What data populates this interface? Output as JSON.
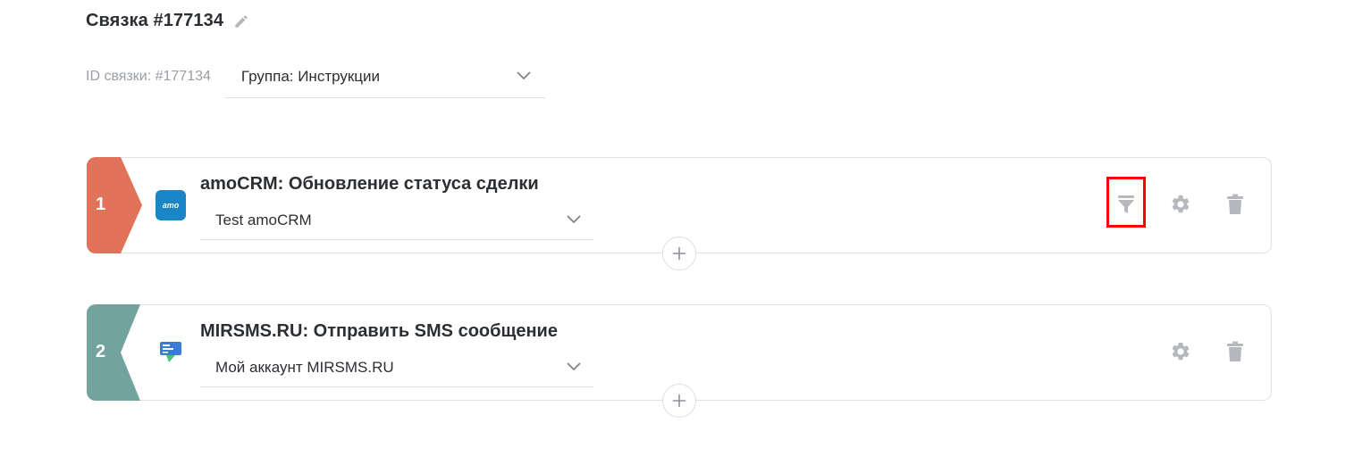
{
  "header": {
    "title": "Связка #177134",
    "id_label": "ID связки: #177134",
    "group_value": "Группа: Инструкции"
  },
  "steps": [
    {
      "number": "1",
      "badge_color": "#e0735a",
      "title": "amoCRM: Обновление статуса сделки",
      "account": "Test amoCRM",
      "logo_text": "amo",
      "logo_color": "#1a86c6",
      "actions": [
        "filter-icon",
        "gear-icon",
        "trash-icon"
      ]
    },
    {
      "number": "2",
      "badge_color": "#72a39e",
      "title": "MIRSMS.RU: Отправить SMS сообщение",
      "account": "Мой аккаунт MIRSMS.RU",
      "logo_color": "#3b7bd8",
      "actions": [
        "gear-icon",
        "trash-icon"
      ]
    }
  ],
  "colors": {
    "icon_gray": "#b5b9bd",
    "highlight": "#ff0000",
    "border": "#dfe2e5"
  }
}
